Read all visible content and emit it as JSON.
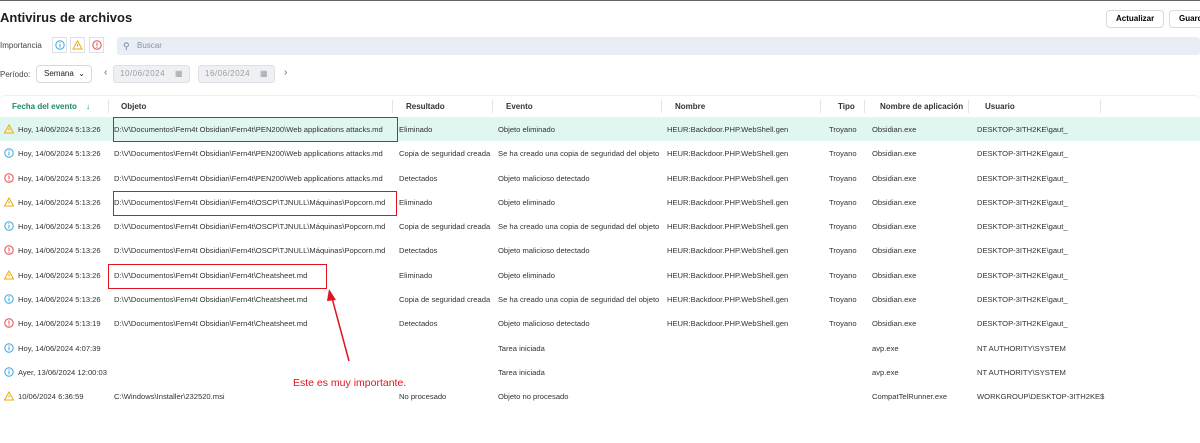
{
  "header": {
    "title": "Antivirus de archivos",
    "refresh_label": "Actualizar",
    "save_label": "Guard"
  },
  "filters": {
    "importance_label": "Importancia",
    "search_placeholder": "Buscar",
    "period_label": "Período:",
    "period_value": "Semana",
    "date_from": "10/06/2024",
    "date_to": "16/06/2024"
  },
  "table": {
    "columns": [
      "Fecha del evento",
      "Objeto",
      "Resultado",
      "Evento",
      "Nombre",
      "Tipo",
      "Nombre de aplicación",
      "Usuario"
    ],
    "rows": [
      {
        "severity": "warning",
        "date": "Hoy, 14/06/2024 5:13:26",
        "object": "D:\\V\\Documentos\\Fern4t Obsidian\\Fern4t\\PEN200\\Web applications attacks.md",
        "result": "Eliminado",
        "event": "Objeto eliminado",
        "name": "HEUR:Backdoor.PHP.WebShell.gen",
        "type": "Troyano",
        "app": "Obsidian.exe",
        "user": "DESKTOP-3ITH2KE\\gaut_"
      },
      {
        "severity": "info",
        "date": "Hoy, 14/06/2024 5:13:26",
        "object": "D:\\V\\Documentos\\Fern4t Obsidian\\Fern4t\\PEN200\\Web applications attacks.md",
        "result": "Copia de seguridad creada",
        "event": "Se ha creado una copia de seguridad del objeto",
        "name": "HEUR:Backdoor.PHP.WebShell.gen",
        "type": "Troyano",
        "app": "Obsidian.exe",
        "user": "DESKTOP-3ITH2KE\\gaut_"
      },
      {
        "severity": "error",
        "date": "Hoy, 14/06/2024 5:13:26",
        "object": "D:\\V\\Documentos\\Fern4t Obsidian\\Fern4t\\PEN200\\Web applications attacks.md",
        "result": "Detectados",
        "event": "Objeto malicioso detectado",
        "name": "HEUR:Backdoor.PHP.WebShell.gen",
        "type": "Troyano",
        "app": "Obsidian.exe",
        "user": "DESKTOP-3ITH2KE\\gaut_"
      },
      {
        "severity": "warning",
        "date": "Hoy, 14/06/2024 5:13:26",
        "object": "D:\\V\\Documentos\\Fern4t Obsidian\\Fern4t\\OSCP\\TJNULL\\Máquinas\\Popcorn.md",
        "result": "Eliminado",
        "event": "Objeto eliminado",
        "name": "HEUR:Backdoor.PHP.WebShell.gen",
        "type": "Troyano",
        "app": "Obsidian.exe",
        "user": "DESKTOP-3ITH2KE\\gaut_"
      },
      {
        "severity": "info",
        "date": "Hoy, 14/06/2024 5:13:26",
        "object": "D:\\V\\Documentos\\Fern4t Obsidian\\Fern4t\\OSCP\\TJNULL\\Máquinas\\Popcorn.md",
        "result": "Copia de seguridad creada",
        "event": "Se ha creado una copia de seguridad del objeto",
        "name": "HEUR:Backdoor.PHP.WebShell.gen",
        "type": "Troyano",
        "app": "Obsidian.exe",
        "user": "DESKTOP-3ITH2KE\\gaut_"
      },
      {
        "severity": "error",
        "date": "Hoy, 14/06/2024 5:13:26",
        "object": "D:\\V\\Documentos\\Fern4t Obsidian\\Fern4t\\OSCP\\TJNULL\\Máquinas\\Popcorn.md",
        "result": "Detectados",
        "event": "Objeto malicioso detectado",
        "name": "HEUR:Backdoor.PHP.WebShell.gen",
        "type": "Troyano",
        "app": "Obsidian.exe",
        "user": "DESKTOP-3ITH2KE\\gaut_"
      },
      {
        "severity": "warning",
        "date": "Hoy, 14/06/2024 5:13:26",
        "object": "D:\\V\\Documentos\\Fern4t Obsidian\\Fern4t\\Cheatsheet.md",
        "result": "Eliminado",
        "event": "Objeto eliminado",
        "name": "HEUR:Backdoor.PHP.WebShell.gen",
        "type": "Troyano",
        "app": "Obsidian.exe",
        "user": "DESKTOP-3ITH2KE\\gaut_"
      },
      {
        "severity": "info",
        "date": "Hoy, 14/06/2024 5:13:26",
        "object": "D:\\V\\Documentos\\Fern4t Obsidian\\Fern4t\\Cheatsheet.md",
        "result": "Copia de seguridad creada",
        "event": "Se ha creado una copia de seguridad del objeto",
        "name": "HEUR:Backdoor.PHP.WebShell.gen",
        "type": "Troyano",
        "app": "Obsidian.exe",
        "user": "DESKTOP-3ITH2KE\\gaut_"
      },
      {
        "severity": "error",
        "date": "Hoy, 14/06/2024 5:13:19",
        "object": "D:\\V\\Documentos\\Fern4t Obsidian\\Fern4t\\Cheatsheet.md",
        "result": "Detectados",
        "event": "Objeto malicioso detectado",
        "name": "HEUR:Backdoor.PHP.WebShell.gen",
        "type": "Troyano",
        "app": "Obsidian.exe",
        "user": "DESKTOP-3ITH2KE\\gaut_"
      },
      {
        "severity": "info",
        "date": "Hoy, 14/06/2024 4:07:39",
        "object": "",
        "result": "",
        "event": "Tarea iniciada",
        "name": "",
        "type": "",
        "app": "avp.exe",
        "user": "NT AUTHORITY\\SYSTEM"
      },
      {
        "severity": "info",
        "date": "Ayer, 13/06/2024 12:00:03",
        "object": "",
        "result": "",
        "event": "Tarea iniciada",
        "name": "",
        "type": "",
        "app": "avp.exe",
        "user": "NT AUTHORITY\\SYSTEM"
      },
      {
        "severity": "warning",
        "date": "10/06/2024 6:36:59",
        "object": "C:\\Windows\\Installer\\232520.msi",
        "result": "No procesado",
        "event": "Objeto no procesado",
        "name": "",
        "type": "",
        "app": "CompatTelRunner.exe",
        "user": "WORKGROUP\\DESKTOP-3ITH2KE$"
      }
    ]
  },
  "annotation": {
    "text": "Este es muy importante."
  },
  "colors": {
    "accent": "#1b8a6b",
    "highlight_row": "#dff6f1",
    "info": "#3aa7e0",
    "warning": "#f2a900",
    "error": "#e5484d",
    "annotation": "#e0141c"
  }
}
